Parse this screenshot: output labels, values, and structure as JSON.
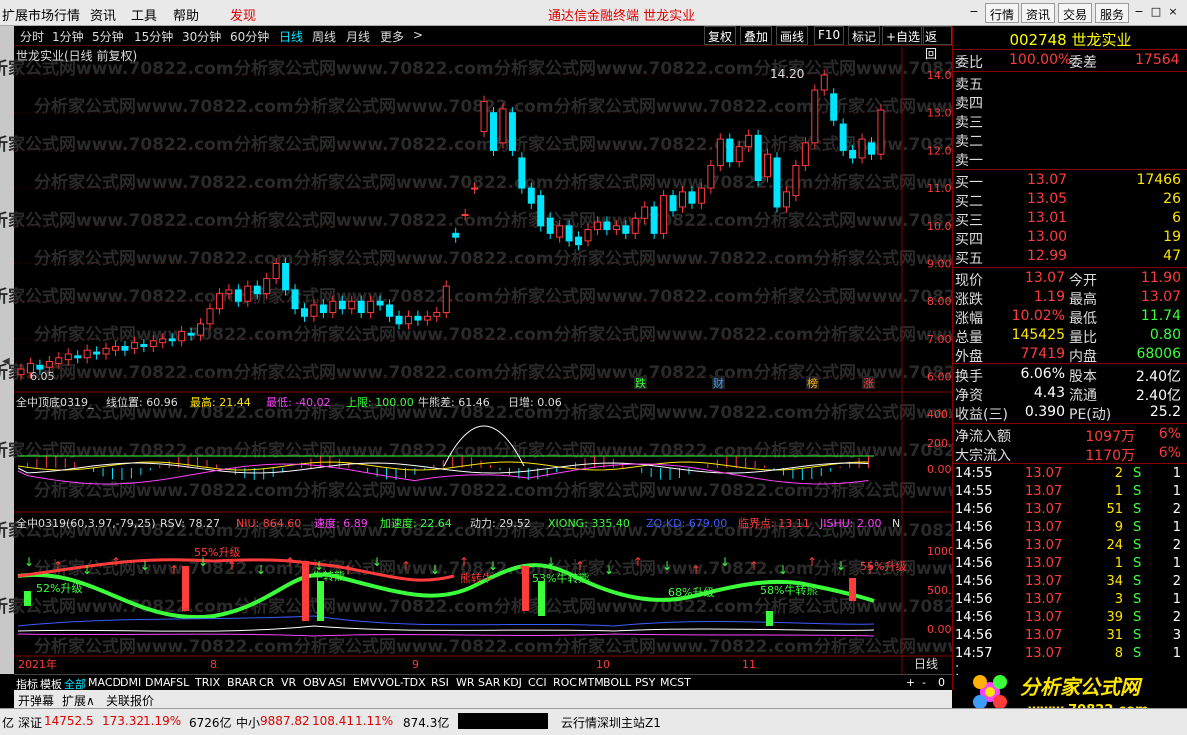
{
  "menu": {
    "items": [
      "扩展市场行情",
      "资讯",
      "工具",
      "帮助"
    ],
    "discover": "发现",
    "title": "通达信金融终端   世龙实业",
    "right_buttons": [
      "行情",
      "资讯",
      "交易",
      "服务"
    ],
    "win_controls": [
      "−",
      "□",
      "×"
    ]
  },
  "periods": [
    "分时",
    "1分钟",
    "5分钟",
    "15分钟",
    "30分钟",
    "60分钟",
    "日线",
    "周线",
    "月线",
    "更多"
  ],
  "active_period": "日线",
  "more_arrow": ">",
  "toolbar": [
    "复权",
    "叠加",
    "画线",
    "F10",
    "标记",
    "+自选",
    "返回"
  ],
  "chart": {
    "title": "世龙实业(日线 前复权)",
    "high_label": "14.20",
    "low_label": "6.05",
    "price_ticks": [
      "14.00",
      "13.00",
      "12.00",
      "11.00",
      "10.00",
      "9.00",
      "8.00",
      "7.00",
      "6.00"
    ],
    "events": [
      {
        "text": "跌",
        "color": "#3cff3c"
      },
      {
        "text": "财",
        "color": "#3c9cff"
      },
      {
        "text": "榜",
        "color": "#ffb000"
      },
      {
        "text": "涨",
        "color": "#ff3c3c"
      }
    ],
    "watermark": "分析家公式网www.70822.com"
  },
  "ind1": {
    "name": "全中顶底0319_",
    "line_pos": "线位置: 60.96",
    "high": "最高: 21.44",
    "low": "最低: -40.02",
    "upper": "上限: 100.00",
    "bullbear": "牛熊差: 61.46",
    "day_inc": "日增: 0.06",
    "ticks": [
      "400.0",
      "200.0",
      "0.00"
    ]
  },
  "ind2": {
    "name": "全中0319(60,3.97,-79,25)",
    "rsv": "RSV: 78.27",
    "niu": "NIU: 864.60",
    "speed": "速度: 6.89",
    "accel": "加速度: 22.64",
    "power": "动力: 29.52",
    "xiong": "XIONG: 335.40",
    "zq": "ZQ:KD: 679.00",
    "critical": "临界点: 13.11",
    "jishu": "JISHU: 2.00",
    "extra": "N",
    "ticks": [
      "1000",
      "500.0",
      "0.00"
    ],
    "labels": [
      "55%升级",
      "52%升级",
      "牛转熊",
      "熊转牛",
      "53%牛转熊",
      "68%升级",
      "58%牛转熊",
      "55%升级"
    ]
  },
  "xaxis": {
    "labels": [
      "2021年",
      "8",
      "9",
      "10",
      "11"
    ],
    "period": "日线"
  },
  "quote": {
    "code": "002748",
    "name": "世龙实业",
    "weibi_label": "委比",
    "weibi": "100.00%",
    "weicha_label": "委差",
    "weicha": "17564",
    "sells": [
      {
        "label": "卖五",
        "price": "",
        "vol": ""
      },
      {
        "label": "卖四",
        "price": "",
        "vol": ""
      },
      {
        "label": "卖三",
        "price": "",
        "vol": ""
      },
      {
        "label": "卖二",
        "price": "",
        "vol": ""
      },
      {
        "label": "卖一",
        "price": "",
        "vol": ""
      }
    ],
    "buys": [
      {
        "label": "买一",
        "price": "13.07",
        "vol": "17466"
      },
      {
        "label": "买二",
        "price": "13.05",
        "vol": "26"
      },
      {
        "label": "买三",
        "price": "13.01",
        "vol": "6"
      },
      {
        "label": "买四",
        "price": "13.00",
        "vol": "19"
      },
      {
        "label": "买五",
        "price": "12.99",
        "vol": "47"
      }
    ],
    "stats": [
      {
        "l1": "现价",
        "v1": "13.07",
        "c1": "red",
        "l2": "今开",
        "v2": "11.90",
        "c2": "red"
      },
      {
        "l1": "涨跌",
        "v1": "1.19",
        "c1": "red",
        "l2": "最高",
        "v2": "13.07",
        "c2": "red"
      },
      {
        "l1": "涨幅",
        "v1": "10.02%",
        "c1": "red",
        "l2": "最低",
        "v2": "11.74",
        "c2": "green"
      },
      {
        "l1": "总量",
        "v1": "145425",
        "c1": "yellow",
        "l2": "量比",
        "v2": "0.80",
        "c2": "green"
      },
      {
        "l1": "外盘",
        "v1": "77419",
        "c1": "red",
        "l2": "内盘",
        "v2": "68006",
        "c2": "green"
      }
    ],
    "fund": [
      {
        "l1": "换手",
        "v1": "6.06%",
        "l2": "股本",
        "v2": "2.40亿"
      },
      {
        "l1": "净资",
        "v1": "4.43",
        "l2": "流通",
        "v2": "2.40亿"
      },
      {
        "l1": "收益(三)",
        "v1": "0.390",
        "l2": "PE(动)",
        "v2": "25.2"
      }
    ],
    "flows": [
      {
        "label": "净流入额",
        "val": "1097万",
        "pct": "6%"
      },
      {
        "label": "大宗流入",
        "val": "1170万",
        "pct": "6%"
      }
    ],
    "ticks": [
      {
        "t": "14:55",
        "p": "13.07",
        "v": "2",
        "s": "S",
        "n": "1"
      },
      {
        "t": "14:55",
        "p": "13.07",
        "v": "1",
        "s": "S",
        "n": "1"
      },
      {
        "t": "14:56",
        "p": "13.07",
        "v": "51",
        "s": "S",
        "n": "2"
      },
      {
        "t": "14:56",
        "p": "13.07",
        "v": "9",
        "s": "S",
        "n": "1"
      },
      {
        "t": "14:56",
        "p": "13.07",
        "v": "24",
        "s": "S",
        "n": "2"
      },
      {
        "t": "14:56",
        "p": "13.07",
        "v": "1",
        "s": "S",
        "n": "1"
      },
      {
        "t": "14:56",
        "p": "13.07",
        "v": "34",
        "s": "S",
        "n": "2"
      },
      {
        "t": "14:56",
        "p": "13.07",
        "v": "3",
        "s": "S",
        "n": "1"
      },
      {
        "t": "14:56",
        "p": "13.07",
        "v": "39",
        "s": "S",
        "n": "2"
      },
      {
        "t": "14:56",
        "p": "13.07",
        "v": "31",
        "s": "S",
        "n": "3"
      },
      {
        "t": "14:57",
        "p": "13.07",
        "v": "8",
        "s": "S",
        "n": "1"
      },
      {
        "t": "15:",
        "p": "",
        "v": "",
        "s": "",
        "n": ""
      }
    ]
  },
  "idxtabs": [
    "指标",
    "模板",
    "全部",
    "MACD",
    "DMI",
    "DMA",
    "FSL",
    "TRIX",
    "BRAR",
    "CR",
    "VR",
    "OBV",
    "ASI",
    "EMV",
    "VOL-TDX",
    "RSI",
    "WR",
    "SAR",
    "KDJ",
    "CCI",
    "ROC",
    "MTM",
    "BOLL",
    "PSY",
    "MCST"
  ],
  "idxtabs_active": "全部",
  "idxtabs_right": [
    "+",
    "-",
    "0"
  ],
  "bottom2": [
    "开弹幕",
    "扩展∧",
    "关联报价"
  ],
  "status": {
    "left": "亿",
    "sz_label": "深证",
    "sz_val": "14752.5",
    "sz_chg": "173.32",
    "sz_pct": "1.19%",
    "sz_amt": "6726亿",
    "zx_label": "中小",
    "zx_val": "9887.82",
    "zx_chg": "108.41",
    "zx_pct": "1.11%",
    "zx_amt": "874.3亿",
    "server": "云行情深圳主站Z1"
  },
  "logo": {
    "text": "分析家公式网",
    "url": "www.70822.com"
  }
}
